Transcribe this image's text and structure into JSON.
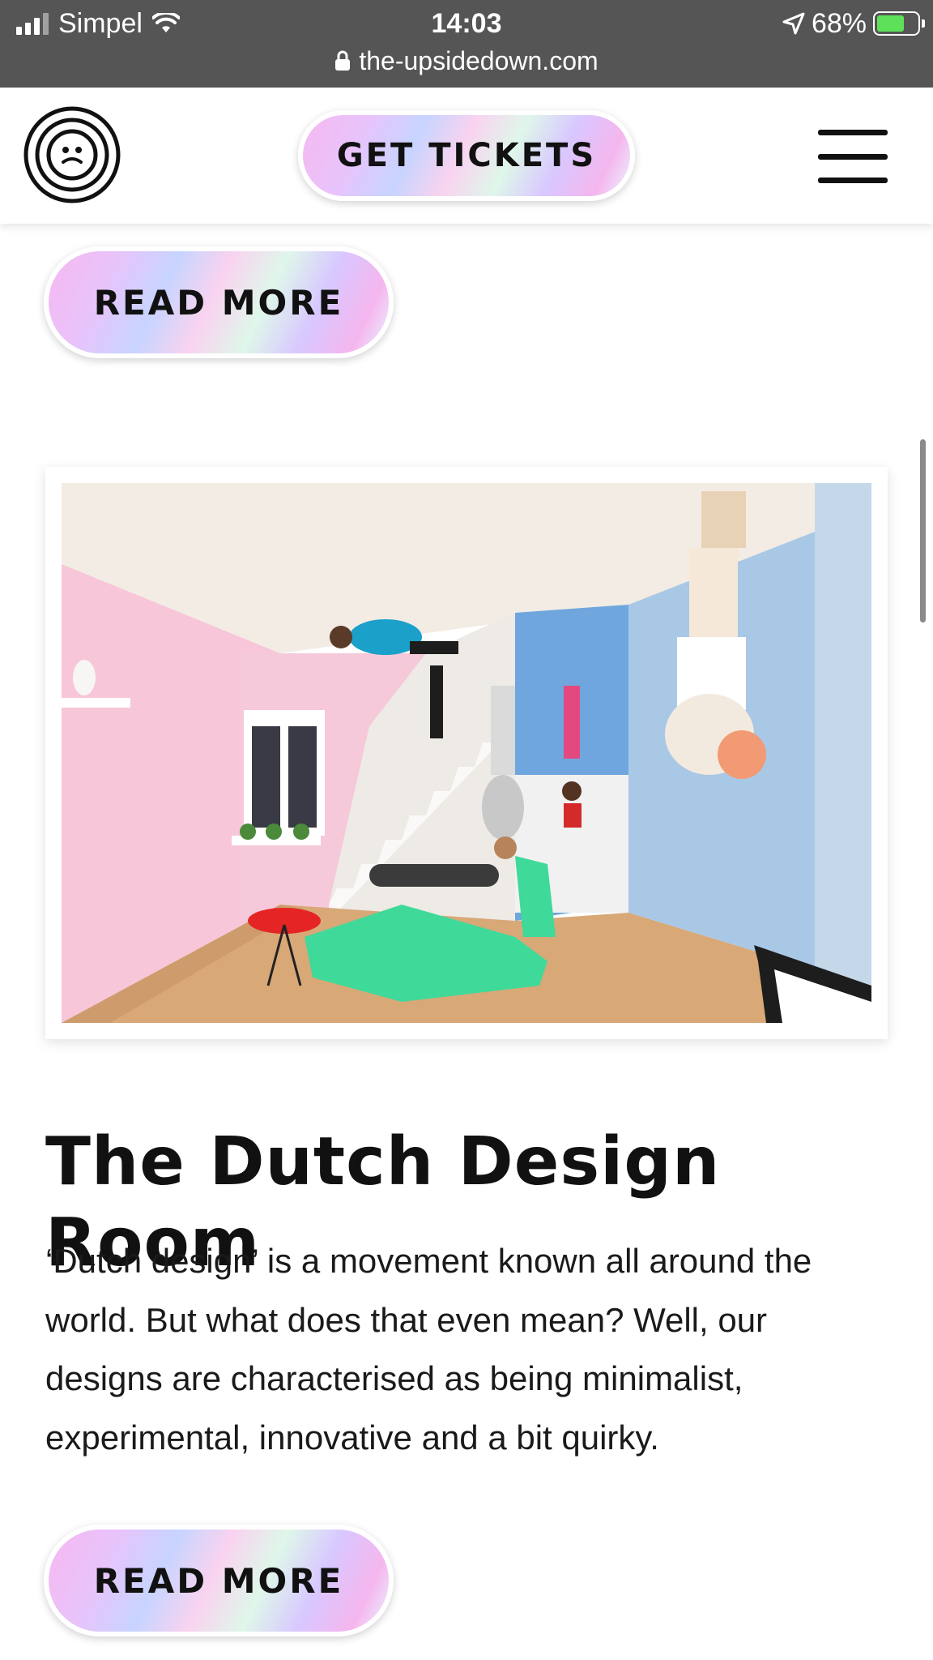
{
  "status_bar": {
    "carrier": "Simpel",
    "time": "14:03",
    "battery_percent": "68%",
    "battery_level": 0.68,
    "url": "the-upsidedown.com"
  },
  "header": {
    "get_tickets_label": "GET TICKETS"
  },
  "sections": {
    "previous_read_more": "READ MORE",
    "room": {
      "title": "The Dutch Design Room",
      "description": "‘Dutch design’ is a movement known all around the world. But what does that even mean? Well, our designs are characterised as being minimalist, experimental, innovative and a bit quirky.",
      "read_more": "READ MORE"
    }
  },
  "colors": {
    "status_bar_bg": "#555555",
    "battery_green": "#5ee05a",
    "pink_wall": "#f7c6d9",
    "blue_wall": "#a9c8e6",
    "chaise_green": "#3fd99a",
    "floor": "#d8a877"
  },
  "icons": [
    "signal-icon",
    "wifi-icon",
    "location-arrow-icon",
    "battery-icon",
    "lock-icon",
    "logo-icon",
    "hamburger-menu-icon"
  ]
}
